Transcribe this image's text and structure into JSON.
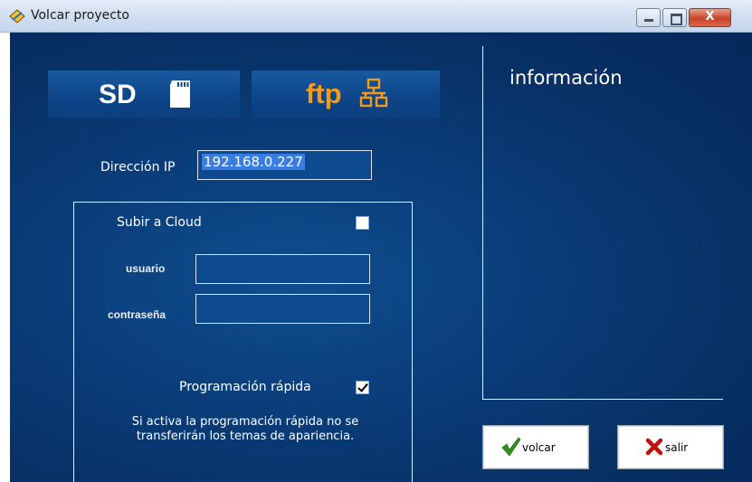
{
  "window": {
    "title": "Volcar proyecto",
    "title_icon": "pencil-diamond-icon",
    "caption_buttons": [
      "minimize-icon",
      "maximize-icon",
      "close-icon"
    ],
    "close_glyph": "X"
  },
  "tabs": {
    "sd_label": "SD",
    "sd_icon": "sd-card-icon",
    "ftp_label": "ftp",
    "ftp_icon": "network-icon",
    "ftp_color": "#f39a1a"
  },
  "form": {
    "ip_label": "Dirección IP",
    "ip_value": "192.168.0.227",
    "cloud_label": "Subir a Cloud",
    "cloud_checked": false,
    "user_label": "usuario",
    "user_value": "",
    "password_label": "contraseña",
    "password_value": "",
    "quick_label": "Programación rápida",
    "quick_checked": true,
    "quick_note_line1": "Si activa la programación rápida no se",
    "quick_note_line2": "transferirán los temas de apariencia."
  },
  "info": {
    "title": "información"
  },
  "buttons": {
    "volcar_label": "volcar",
    "volcar_icon": "check-icon",
    "salir_label": "salir",
    "salir_icon": "x-icon"
  },
  "colors": {
    "background": "#0a3c78",
    "tab": "#0d4689",
    "ftp_accent": "#f39a1a",
    "check_green": "#2f8f1f",
    "x_red": "#c01010"
  }
}
